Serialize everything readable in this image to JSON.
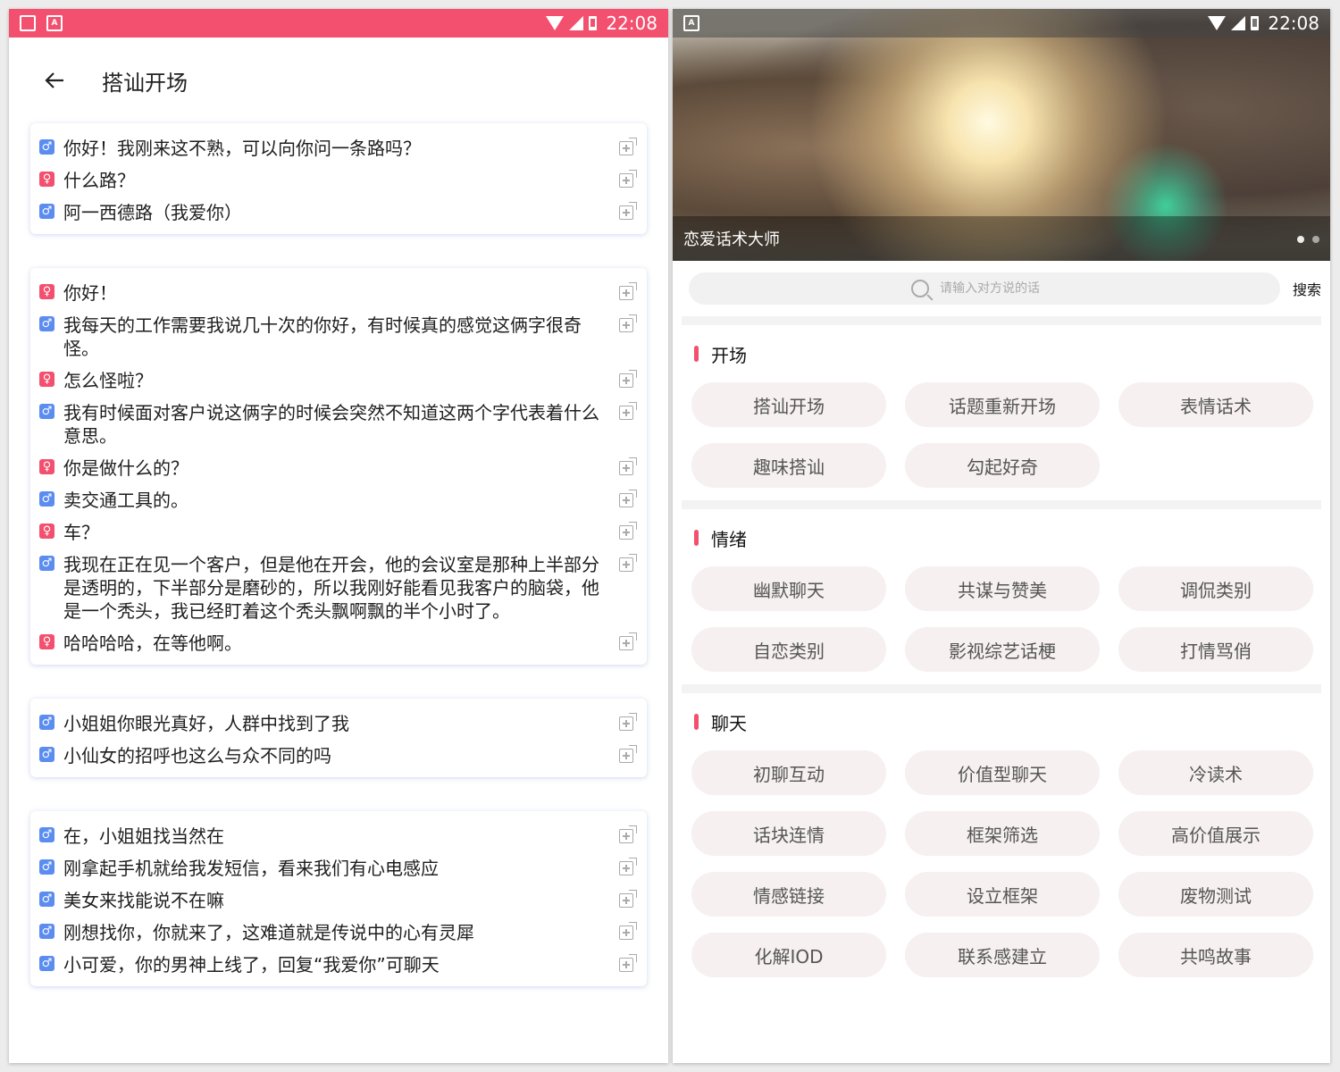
{
  "status_bar": {
    "time": "22:08"
  },
  "left": {
    "title": "搭讪开场",
    "cards": [
      {
        "lines": [
          {
            "gender": "male",
            "text": "你好！我刚来这不熟，可以向你问一条路吗？"
          },
          {
            "gender": "female",
            "text": "什么路？"
          },
          {
            "gender": "male",
            "text": "阿一西德路（我爱你）"
          }
        ]
      },
      {
        "lines": [
          {
            "gender": "female",
            "text": "你好！"
          },
          {
            "gender": "male",
            "text": "我每天的工作需要我说几十次的你好，有时候真的感觉这俩字很奇怪。"
          },
          {
            "gender": "female",
            "text": "怎么怪啦？"
          },
          {
            "gender": "male",
            "text": "我有时候面对客户说这俩字的时候会突然不知道这两个字代表着什么意思。"
          },
          {
            "gender": "female",
            "text": "你是做什么的？"
          },
          {
            "gender": "male",
            "text": "卖交通工具的。"
          },
          {
            "gender": "female",
            "text": "车？"
          },
          {
            "gender": "male",
            "text": "我现在正在见一个客户，但是他在开会，他的会议室是那种上半部分是透明的，下半部分是磨砂的，所以我刚好能看见我客户的脑袋，他是一个秃头，我已经盯着这个秃头飘啊飘的半个小时了。"
          },
          {
            "gender": "female",
            "text": "哈哈哈哈，在等他啊。"
          }
        ]
      },
      {
        "lines": [
          {
            "gender": "male",
            "text": "小姐姐你眼光真好，人群中找到了我"
          },
          {
            "gender": "male",
            "text": "小仙女的招呼也这么与众不同的吗"
          }
        ]
      },
      {
        "lines": [
          {
            "gender": "male",
            "text": "在，小姐姐找当然在"
          },
          {
            "gender": "male",
            "text": "刚拿起手机就给我发短信，看来我们有心电感应"
          },
          {
            "gender": "male",
            "text": "美女来找能说不在嘛"
          },
          {
            "gender": "male",
            "text": "刚想找你，你就来了，这难道就是传说中的心有灵犀"
          },
          {
            "gender": "male",
            "text": "小可爱，你的男神上线了，回复“我爱你”可聊天"
          }
        ]
      }
    ]
  },
  "right": {
    "banner_caption": "恋爱话术大师",
    "search": {
      "placeholder": "请输入对方说的话",
      "button": "搜索"
    },
    "sections": [
      {
        "title": "开场",
        "chips": [
          "搭讪开场",
          "话题重新开场",
          "表情话术",
          "趣味搭讪",
          "勾起好奇"
        ]
      },
      {
        "title": "情绪",
        "chips": [
          "幽默聊天",
          "共谋与赞美",
          "调侃类别",
          "自恋类别",
          "影视综艺话梗",
          "打情骂俏"
        ]
      },
      {
        "title": "聊天",
        "chips": [
          "初聊互动",
          "价值型聊天",
          "冷读术",
          "话块连情",
          "框架筛选",
          "高价值展示",
          "情感链接",
          "设立框架",
          "废物测试",
          "化解IOD",
          "联系感建立",
          "共鸣故事"
        ]
      }
    ]
  },
  "colors": {
    "accent": "#f2506e",
    "male_icon": "#5b8cf0",
    "female_icon": "#f2506e"
  },
  "icons": {
    "male": "male-icon",
    "female": "female-icon",
    "add": "add-to-favorites-icon",
    "back": "arrow-left-icon",
    "search": "search-icon"
  }
}
